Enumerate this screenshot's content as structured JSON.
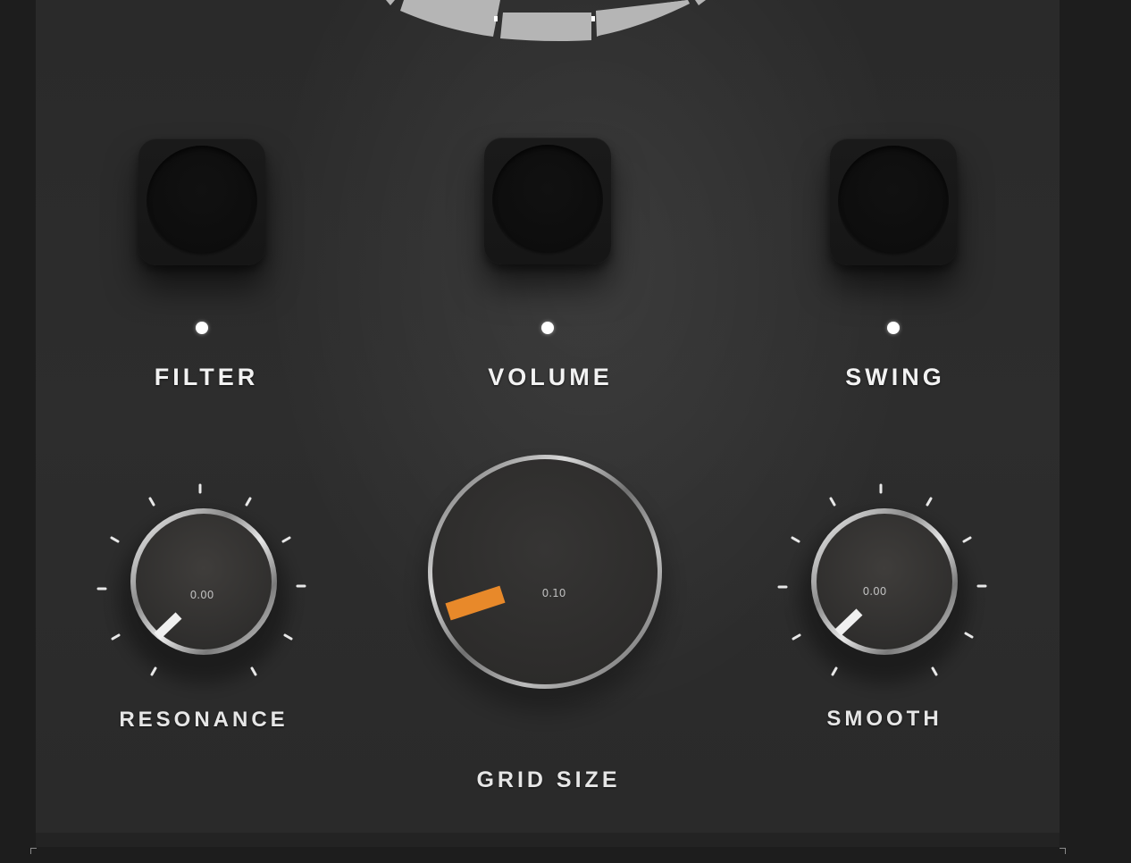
{
  "pads": [
    {
      "id": "filter",
      "label": "FILTER"
    },
    {
      "id": "volume",
      "label": "VOLUME"
    },
    {
      "id": "swing",
      "label": "SWING"
    }
  ],
  "knobs": {
    "resonance": {
      "label": "RESONANCE",
      "value": "0.00"
    },
    "grid_size": {
      "label": "GRID SIZE",
      "value": "0.10"
    },
    "smooth": {
      "label": "SMOOTH",
      "value": "0.00"
    }
  },
  "colors": {
    "accent": "#e8892a",
    "pointer_white": "#f0f0f0",
    "led": "#ffffff",
    "panel": "#2c2c2c"
  }
}
